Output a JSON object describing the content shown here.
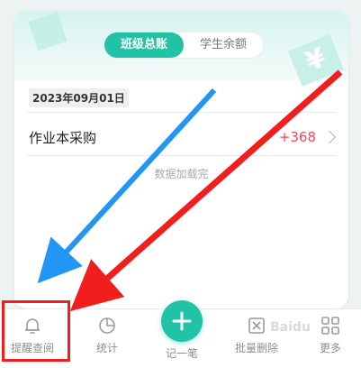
{
  "header": {
    "tabs": [
      {
        "label": "班级总账",
        "active": true
      },
      {
        "label": "学生余额",
        "active": false
      }
    ],
    "accent_color": "#21c2a6"
  },
  "record": {
    "date": "2023年09月01日",
    "items": [
      {
        "name": "作业本采购",
        "amount": "+368"
      }
    ],
    "amount_color": "#f1475a",
    "end_text": "数据加载完"
  },
  "bottom_nav": {
    "items": [
      {
        "label": "提醒查阅",
        "icon": "bell-icon"
      },
      {
        "label": "统计",
        "icon": "pie-chart-icon"
      },
      {
        "label": "记一笔",
        "icon": "plus-icon"
      },
      {
        "label": "批量删除",
        "icon": "batch-delete-icon"
      },
      {
        "label": "更多",
        "icon": "grid-icon"
      }
    ]
  },
  "annotations": {
    "blue_arrow_color": "#2196f3",
    "red_arrow_color": "#f21d1d",
    "highlight_color": "#f21d1d"
  }
}
